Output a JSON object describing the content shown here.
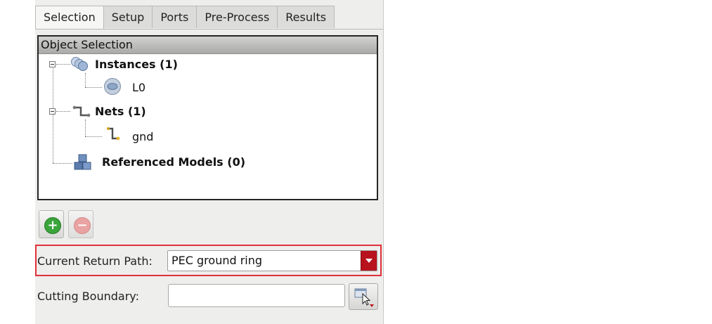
{
  "tabs": [
    {
      "label": "Selection",
      "active": true
    },
    {
      "label": "Setup",
      "active": false
    },
    {
      "label": "Ports",
      "active": false
    },
    {
      "label": "Pre-Process",
      "active": false
    },
    {
      "label": "Results",
      "active": false
    }
  ],
  "tree": {
    "header": "Object Selection",
    "instances_label": "Instances (1)",
    "instance_item": "L0",
    "nets_label": "Nets (1)",
    "net_item": "gnd",
    "models_label": "Referenced Models (0)"
  },
  "actions": {
    "add_icon": "plus-circle-icon",
    "remove_icon": "minus-circle-icon",
    "add_symbol": "+",
    "remove_symbol": "−"
  },
  "return_path": {
    "label": "Current Return Path:",
    "value": "PEC ground ring"
  },
  "cutting_boundary": {
    "label": "Cutting Boundary:",
    "value": ""
  },
  "colors": {
    "highlight": "#e0303a",
    "dropdown_arrow": "#b8121d",
    "add_green": "#3aa53a",
    "remove_red": "#e88a8a"
  }
}
